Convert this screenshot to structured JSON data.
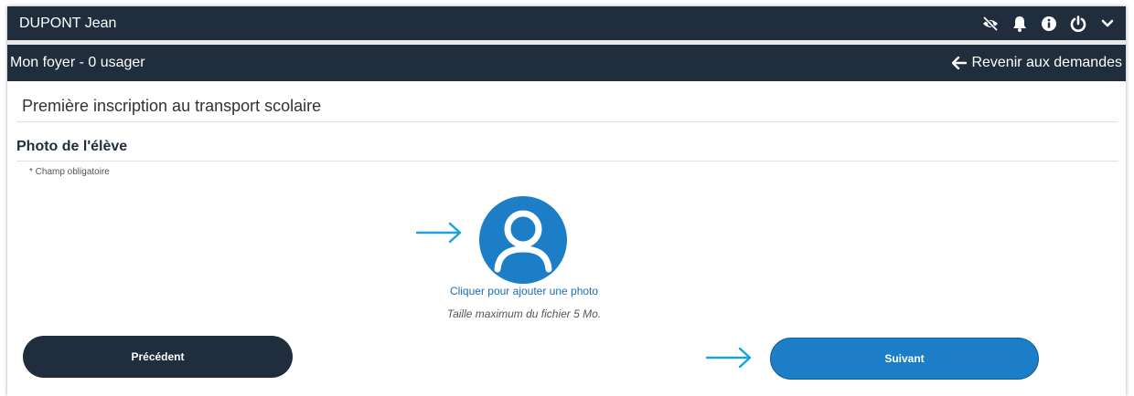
{
  "header": {
    "user_name": "DUPONT Jean",
    "icons": [
      "eye-slash-icon",
      "bell-icon",
      "info-icon",
      "power-icon",
      "chevron-down-icon"
    ]
  },
  "subheader": {
    "household": "Mon foyer - 0 usager",
    "back_label": "Revenir aux demandes"
  },
  "page": {
    "title": "Première inscription au transport scolaire",
    "section_title": "Photo de l'élève",
    "required_note": "* Champ obligatoire"
  },
  "photo": {
    "add_label": "Cliquer pour ajouter une photo",
    "max_size": "Taille maximum du fichier 5 Mo."
  },
  "buttons": {
    "previous": "Précédent",
    "next": "Suivant"
  },
  "colors": {
    "dark": "#1f2d3d",
    "accent": "#1b7ec6",
    "arrow": "#1aa3e0"
  }
}
